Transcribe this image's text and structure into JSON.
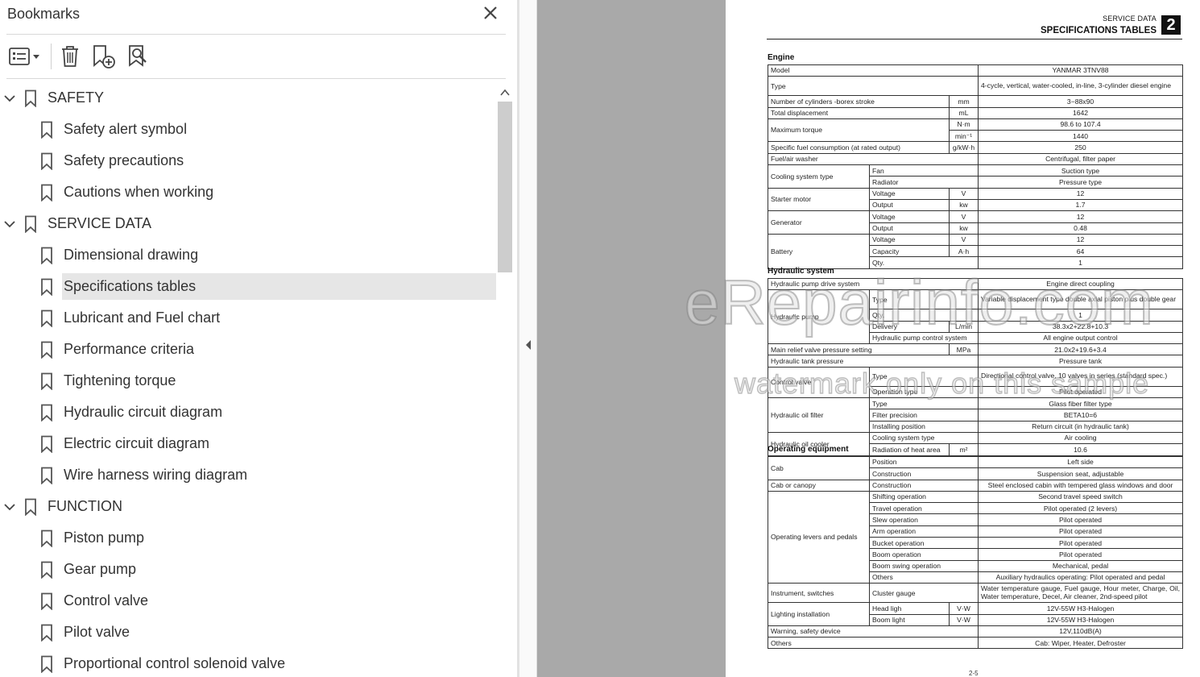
{
  "panel": {
    "title": "Bookmarks",
    "icons": {
      "close": "close-icon",
      "options": "list-options-icon",
      "delete": "trash-icon",
      "add": "add-bookmark-icon",
      "find": "find-bookmark-icon"
    }
  },
  "bookmarks": [
    {
      "label": "SAFETY",
      "level": 0,
      "expanded": true
    },
    {
      "label": "Safety alert symbol",
      "level": 1
    },
    {
      "label": "Safety precautions",
      "level": 1
    },
    {
      "label": "Cautions when working",
      "level": 1
    },
    {
      "label": "SERVICE DATA",
      "level": 0,
      "expanded": true
    },
    {
      "label": "Dimensional drawing",
      "level": 1
    },
    {
      "label": "Specifications tables",
      "level": 1,
      "selected": true
    },
    {
      "label": "Lubricant and Fuel chart",
      "level": 1
    },
    {
      "label": "Performance criteria",
      "level": 1
    },
    {
      "label": "Tightening torque",
      "level": 1
    },
    {
      "label": "Hydraulic circuit diagram",
      "level": 1
    },
    {
      "label": "Electric circuit diagram",
      "level": 1
    },
    {
      "label": "Wire harness wiring diagram",
      "level": 1
    },
    {
      "label": "FUNCTION",
      "level": 0,
      "expanded": true
    },
    {
      "label": "Piston pump",
      "level": 1
    },
    {
      "label": "Gear pump",
      "level": 1
    },
    {
      "label": "Control valve",
      "level": 1
    },
    {
      "label": "Pilot valve",
      "level": 1
    },
    {
      "label": "Proportional control solenoid valve",
      "level": 1
    }
  ],
  "document": {
    "section_name": "SERVICE DATA",
    "section_title": "SPECIFICATIONS TABLES",
    "section_number": "2",
    "page_number": "2-5",
    "watermark_main": "eRepairinfo.com",
    "watermark_sub": "watermark only on this sample",
    "engine_title": "Engine",
    "hydraulic_title": "Hydraulic system",
    "operating_title": "Operating equipment",
    "engine": [
      [
        "Model",
        "",
        "",
        "YANMAR 3TNV88"
      ],
      [
        "Type",
        "",
        "",
        "4-cycle, vertical, water-cooled, in-line, 3-cylinder diesel engine"
      ],
      [
        "Number of cylinders -borex stroke",
        "",
        "mm",
        "3−88x90"
      ],
      [
        "Total displacement",
        "",
        "mL",
        "1642"
      ],
      [
        "Maximum torque",
        "",
        "N·m",
        "98.6 to 107.4"
      ],
      [
        "",
        "",
        "min⁻¹",
        "1440"
      ],
      [
        "Specific fuel consumption (at rated output)",
        "",
        "g/kW·h",
        "250"
      ],
      [
        "Fuel/air washer",
        "",
        "",
        "Centrifugal, filter paper"
      ],
      [
        "Cooling system type",
        "Fan",
        "",
        "Suction type"
      ],
      [
        "",
        "Radiator",
        "",
        "Pressure type"
      ],
      [
        "Starter motor",
        "Voltage",
        "V",
        "12"
      ],
      [
        "",
        "Output",
        "kw",
        "1.7"
      ],
      [
        "Generator",
        "Voltage",
        "V",
        "12"
      ],
      [
        "",
        "Output",
        "kw",
        "0.48"
      ],
      [
        "Battery",
        "Voltage",
        "V",
        "12"
      ],
      [
        "",
        "Capacity",
        "A·h",
        "64"
      ],
      [
        "",
        "Qty.",
        "",
        "1"
      ]
    ],
    "hydraulic": [
      [
        "Hydraulic pump drive system",
        "",
        "",
        "Engine direct coupling"
      ],
      [
        "Hydraulic pump",
        "Type",
        "",
        "Variable displacement type double axial piston plus double gear"
      ],
      [
        "",
        "Qty.",
        "",
        "1"
      ],
      [
        "",
        "Delivery",
        "L/min",
        "38.3x2+22.8+10.3"
      ],
      [
        "",
        "Hydraulic pump control system",
        "",
        "All engine output control"
      ],
      [
        "Main relief valve pressure setting",
        "",
        "MPa",
        "21.0x2+19.6+3.4"
      ],
      [
        "Hydraulic tank pressure",
        "",
        "",
        "Pressure tank"
      ],
      [
        "Control valve",
        "Type",
        "",
        "Directional control valve, 10 valves in series (standard spec.)"
      ],
      [
        "",
        "Operation type",
        "",
        "Pilot operated"
      ],
      [
        "Hydraulic oil filter",
        "Type",
        "",
        "Glass fiber filter type"
      ],
      [
        "",
        "Filter precision",
        "",
        "BETA10=6"
      ],
      [
        "",
        "Installing position",
        "",
        "Return circuit (in hydraulic tank)"
      ],
      [
        "Hydraulic oil cooler",
        "Cooling system type",
        "",
        "Air cooling"
      ],
      [
        "",
        "Radiation of heat area",
        "m²",
        "10.6"
      ]
    ],
    "operating": [
      [
        "Cab",
        "Position",
        "",
        "Left side"
      ],
      [
        "",
        "Construction",
        "",
        "Suspension seat, adjustable"
      ],
      [
        "Cab or canopy",
        "Construction",
        "",
        "Steel enclosed cabin with tempered glass windows and door"
      ],
      [
        "Operating levers and pedals",
        "Shifting operation",
        "",
        "Second travel speed switch"
      ],
      [
        "",
        "Travel operation",
        "",
        "Pilot operated (2 levers)"
      ],
      [
        "",
        "Slew operation",
        "",
        "Pilot operated"
      ],
      [
        "",
        "Arm operation",
        "",
        "Pilot operated"
      ],
      [
        "",
        "Bucket operation",
        "",
        "Pilot operated"
      ],
      [
        "",
        "Boom operation",
        "",
        "Pilot operated"
      ],
      [
        "",
        "Boom swing operation",
        "",
        "Mechanical, pedal"
      ],
      [
        "",
        "Others",
        "",
        "Auxiliary hydraulics operating: Pilot operated and pedal"
      ],
      [
        "Instrument, switches",
        "Cluster gauge",
        "",
        "Water temperature gauge, Fuel gauge, Hour meter, Charge, Oil, Water temperature, Decel, Air cleaner, 2nd-speed pilot"
      ],
      [
        "Lighting installation",
        "Head ligh",
        "V·W",
        "12V-55W H3-Halogen"
      ],
      [
        "",
        "Boom light",
        "V·W",
        "12V-55W H3-Halogen"
      ],
      [
        "Warning,  safety device",
        "",
        "",
        "12V,110dB(A)"
      ],
      [
        "Others",
        "",
        "",
        "Cab: Wiper, Heater, Defroster"
      ]
    ]
  }
}
